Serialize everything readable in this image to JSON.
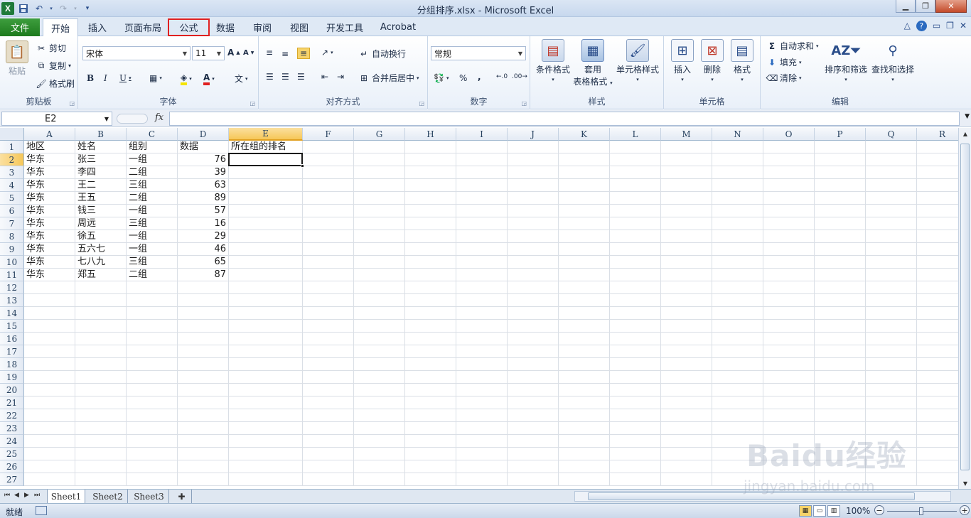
{
  "titlebar": {
    "title": "分组排序.xlsx - Microsoft Excel",
    "logo": "X"
  },
  "tabs": {
    "file": "文件",
    "items": [
      "开始",
      "插入",
      "页面布局",
      "公式",
      "数据",
      "审阅",
      "视图",
      "开发工具",
      "Acrobat"
    ],
    "active": "开始",
    "highlighted": "公式"
  },
  "ribbon": {
    "clipboard": {
      "label": "剪贴板",
      "paste": "粘贴",
      "cut": "剪切",
      "copy": "复制",
      "format_painter": "格式刷"
    },
    "font": {
      "label": "字体",
      "font_name": "宋体",
      "font_size": "11"
    },
    "alignment": {
      "label": "对齐方式",
      "wrap_text": "自动换行",
      "merge_center": "合并后居中"
    },
    "number": {
      "label": "数字",
      "format": "常规",
      "percent": "%",
      "comma": ","
    },
    "styles": {
      "label": "样式",
      "conditional": "条件格式",
      "table_line1": "套用",
      "table_line2": "表格格式",
      "cell_styles": "单元格样式"
    },
    "cells": {
      "label": "单元格",
      "insert": "插入",
      "delete": "删除",
      "format": "格式"
    },
    "editing": {
      "label": "编辑",
      "autosum": "自动求和",
      "fill": "填充",
      "clear": "清除",
      "sort_filter": "排序和筛选",
      "find_select": "查找和选择"
    }
  },
  "formula_bar": {
    "name_box": "E2",
    "fx": "fx",
    "content": ""
  },
  "grid": {
    "columns": [
      "A",
      "B",
      "C",
      "D",
      "E",
      "F",
      "G",
      "H",
      "I",
      "J",
      "K",
      "L",
      "M",
      "N",
      "O",
      "P",
      "Q",
      "R"
    ],
    "selected_column": "E",
    "selected_row": 2,
    "row_count": 27,
    "rows": [
      [
        "地区",
        "姓名",
        "组别",
        "数据",
        "所在组的排名"
      ],
      [
        "华东",
        "张三",
        "一组",
        "76",
        ""
      ],
      [
        "华东",
        "李四",
        "二组",
        "39",
        ""
      ],
      [
        "华东",
        "王二",
        "三组",
        "63",
        ""
      ],
      [
        "华东",
        "王五",
        "二组",
        "89",
        ""
      ],
      [
        "华东",
        "钱三",
        "一组",
        "57",
        ""
      ],
      [
        "华东",
        "周远",
        "三组",
        "16",
        ""
      ],
      [
        "华东",
        "徐五",
        "一组",
        "29",
        ""
      ],
      [
        "华东",
        "五六七",
        "一组",
        "46",
        ""
      ],
      [
        "华东",
        "七八九",
        "三组",
        "65",
        ""
      ],
      [
        "华东",
        "郑五",
        "二组",
        "87",
        ""
      ]
    ]
  },
  "sheets": {
    "tabs": [
      "Sheet1",
      "Sheet2",
      "Sheet3"
    ],
    "active": "Sheet1"
  },
  "status": {
    "ready": "就绪",
    "zoom": "100%"
  },
  "watermark": {
    "brand": "Baidu经验",
    "url": "jingyan.baidu.com"
  },
  "colors": {
    "file_tab": "#1d7a1d",
    "highlight_box": "#e02020",
    "selected_header": "#f6c758"
  }
}
